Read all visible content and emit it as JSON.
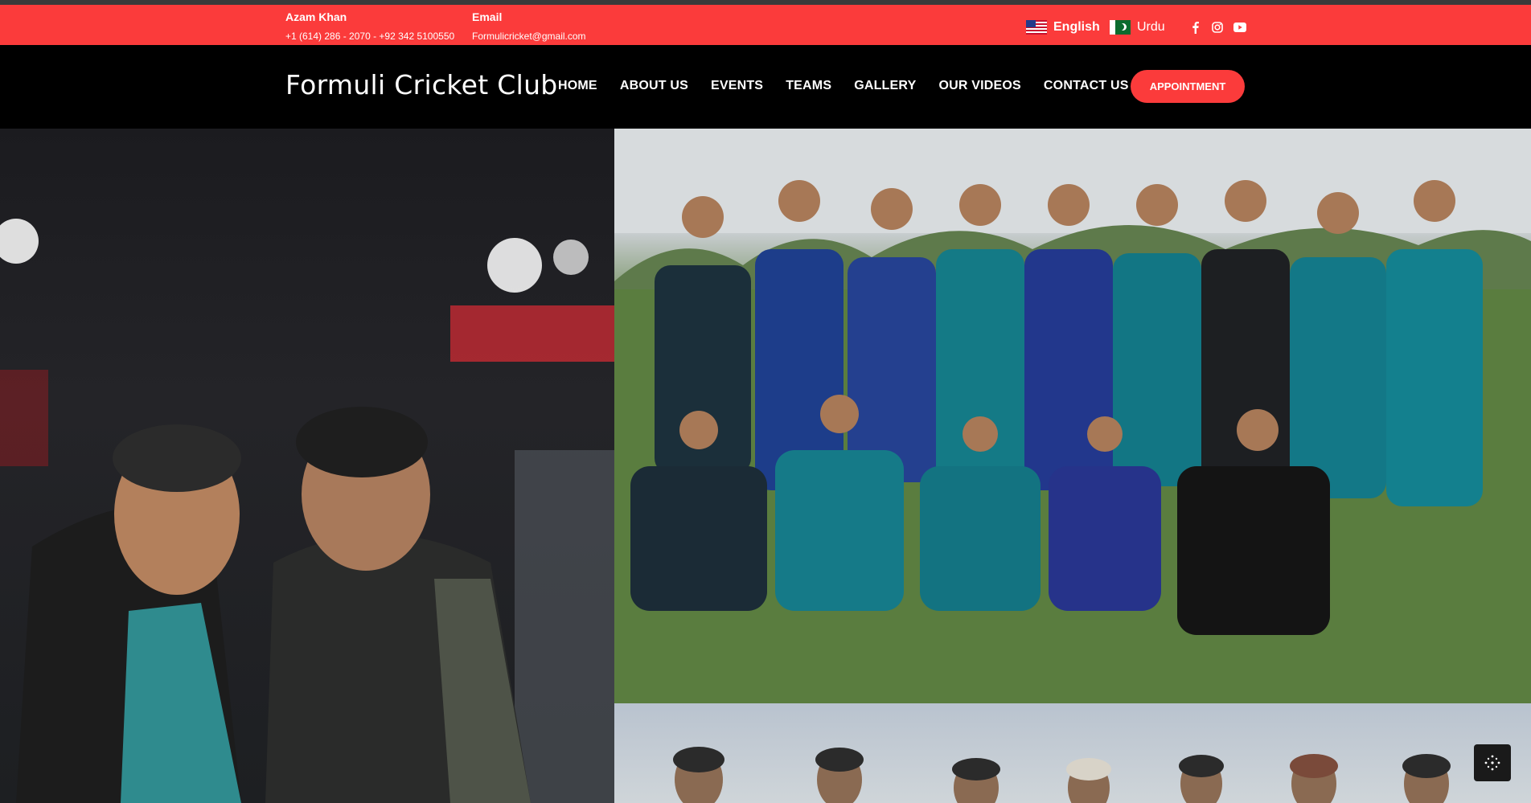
{
  "topbar": {
    "name_label": "Azam Khan",
    "phones": "+1 (614) 286 - 2070 - +92 342 5100550",
    "email_label": "Email",
    "email": "Formulicricket@gmail.com",
    "languages": [
      {
        "label": "English",
        "flag": "us-flag-icon"
      },
      {
        "label": "Urdu",
        "flag": "pakistan-flag-icon"
      }
    ],
    "social": [
      "facebook-icon",
      "instagram-icon",
      "youtube-icon"
    ]
  },
  "header": {
    "brand": "Formuli Cricket Club",
    "nav": [
      "HOME",
      "ABOUT US",
      "EVENTS",
      "TEAMS",
      "GALLERY",
      "OUR VIDEOS",
      "CONTACT US"
    ],
    "cta": "APPOINTMENT"
  },
  "colors": {
    "accent": "#fb3b3b",
    "navbar": "#000000",
    "text_on_dark": "#ffffff"
  }
}
